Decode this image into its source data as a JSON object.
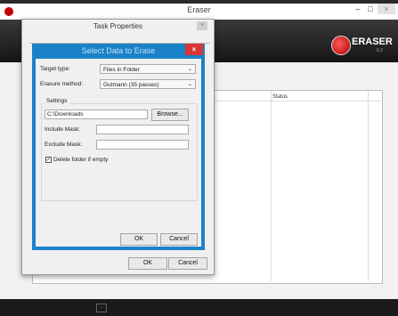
{
  "main": {
    "title": "Eraser",
    "close_glyph": "×",
    "minimize_glyph": "–",
    "maximize_glyph": "□",
    "logo_text": "ERASER",
    "logo_version": "6.2",
    "columns": {
      "status": "Status"
    }
  },
  "task_dialog": {
    "title": "Task Properties",
    "close_glyph": "×",
    "ok_label": "OK",
    "cancel_label": "Cancel"
  },
  "select_dialog": {
    "title": "Select Data to Erase",
    "close_glyph": "×",
    "target_type_label": "Target type:",
    "target_type_value": "Files in Folder",
    "erasure_method_label": "Erasure method:",
    "erasure_method_value": "Gutmann (35 passes)",
    "settings_label": "Settings",
    "folder_path": "C:\\Downloads",
    "browse_label": "Browse...",
    "include_mask_label": "Include Mask:",
    "exclude_mask_label": "Exclude Mask:",
    "delete_folder_label": "Delete folder if empty",
    "delete_folder_checked": true,
    "check_glyph": "✓",
    "ok_label": "OK",
    "cancel_label": "Cancel"
  }
}
